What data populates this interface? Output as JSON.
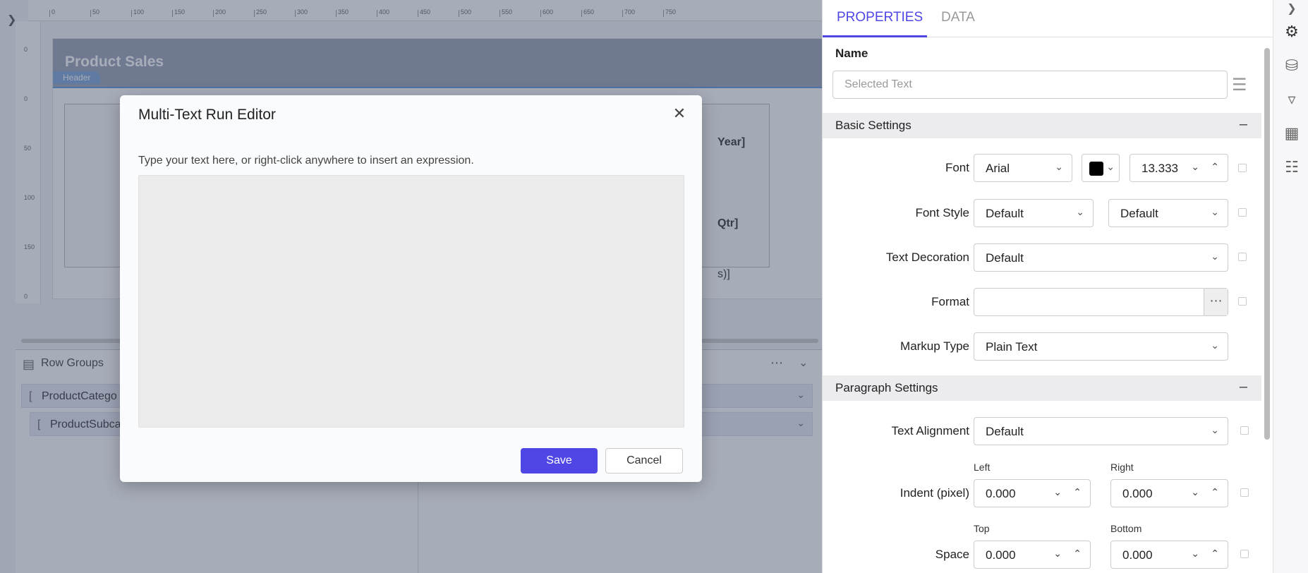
{
  "design": {
    "ruler_ticks": [
      "0",
      "50",
      "100",
      "150",
      "200",
      "250",
      "300",
      "350",
      "400",
      "450",
      "500",
      "550",
      "600",
      "650",
      "700",
      "750"
    ],
    "ruler_left_labels": [
      "0",
      "0",
      "50",
      "100",
      "150",
      "0"
    ],
    "report_title": "Product Sales",
    "header_tag": "Header",
    "cell_year": "Year]",
    "cell_qtr": "Qtr]",
    "cell_sales": "s)]"
  },
  "groups": {
    "row_groups_title": "Row Groups",
    "items": [
      "ProductCatego",
      "ProductSubca"
    ],
    "more_icon": "more-horizontal-icon",
    "collapse_icon": "double-chevron-down-icon"
  },
  "dialog": {
    "title": "Multi-Text Run Editor",
    "hint": "Type your text here, or right-click anywhere to insert an expression.",
    "text_value": "",
    "save_label": "Save",
    "cancel_label": "Cancel"
  },
  "panel": {
    "tabs": [
      "PROPERTIES",
      "DATA"
    ],
    "active_tab": "PROPERTIES",
    "name_label": "Name",
    "name_placeholder": "Selected Text",
    "basic_section": "Basic Settings",
    "paragraph_section": "Paragraph Settings",
    "font_label": "Font",
    "font_value": "Arial",
    "font_color": "#000000",
    "font_size": "13.333",
    "font_style_label": "Font Style",
    "font_style_value": "Default",
    "font_weight_value": "Default",
    "text_decoration_label": "Text Decoration",
    "text_decoration_value": "Default",
    "format_label": "Format",
    "format_value": "",
    "markup_label": "Markup Type",
    "markup_value": "Plain Text",
    "text_alignment_label": "Text Alignment",
    "text_alignment_value": "Default",
    "indent_label": "Indent (pixel)",
    "indent_left_label": "Left",
    "indent_right_label": "Right",
    "indent_left_value": "0.000",
    "indent_right_value": "0.000",
    "space_label": "Space",
    "space_top_label": "Top",
    "space_bottom_label": "Bottom",
    "space_top_value": "0.000",
    "space_bottom_value": "0.000"
  },
  "colors": {
    "accent": "#4f46e5",
    "section_bg": "#ececef",
    "overlay": "rgba(60,70,100,0.45)"
  }
}
